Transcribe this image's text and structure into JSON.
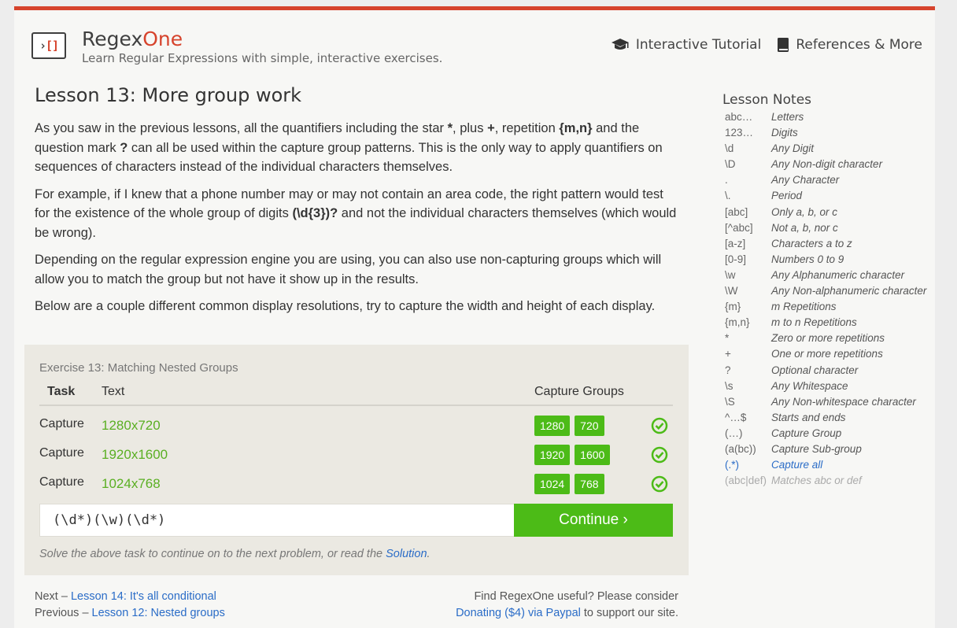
{
  "header": {
    "brand_prefix": "Regex",
    "brand_suffix": "One",
    "logo_gt": "›",
    "logo_brackets": "[]",
    "tagline": "Learn Regular Expressions with simple, interactive exercises.",
    "nav": [
      {
        "label": "Interactive Tutorial",
        "icon": "graduation-cap-icon"
      },
      {
        "label": "References & More",
        "icon": "book-icon"
      }
    ]
  },
  "lesson": {
    "title": "Lesson 13: More group work",
    "p1": {
      "a": "As you saw in the previous lessons, all the quantifiers including the star ",
      "star": "*",
      "b": ", plus ",
      "plus": "+",
      "c": ", repetition ",
      "rep": "{m,n}",
      "d": " and the question mark ",
      "qm": "?",
      "e": " can all be used within the capture group patterns. This is the only way to apply quantifiers on sequences of characters instead of the individual characters themselves."
    },
    "p2": {
      "a": "For example, if I knew that a phone number may or may not contain an area code, the right pattern would test for the existence of the whole group of digits ",
      "code": "(\\d{3})?",
      "b": " and not the individual characters themselves (which would be wrong)."
    },
    "p3": "Depending on the regular expression engine you are using, you can also use non-capturing groups which will allow you to match the group but not have it show up in the results.",
    "p4": "Below are a couple different common display resolutions, try to capture the width and height of each display."
  },
  "exercise": {
    "title": "Exercise 13: Matching Nested Groups",
    "columns": {
      "task": "Task",
      "text": "Text",
      "groups": "Capture Groups"
    },
    "rows": [
      {
        "task": "Capture",
        "text": "1280x720",
        "groups": [
          "1280",
          "720"
        ],
        "status": "check-circle-icon"
      },
      {
        "task": "Capture",
        "text": "1920x1600",
        "groups": [
          "1920",
          "1600"
        ],
        "status": "check-circle-icon"
      },
      {
        "task": "Capture",
        "text": "1024x768",
        "groups": [
          "1024",
          "768"
        ],
        "status": "check-circle-icon"
      }
    ],
    "input_value": "(\\d*)(\\w)(\\d*)",
    "continue_label": "Continue ›",
    "hint_prefix": "Solve the above task to continue on to the next problem, or read the ",
    "hint_link": "Solution",
    "hint_suffix": "."
  },
  "footer": {
    "next_prefix": "Next – ",
    "next_link": "Lesson 14: It's all conditional",
    "prev_prefix": "Previous – ",
    "prev_link": "Lesson 12: Nested groups",
    "support_line1": "Find RegexOne useful? Please consider",
    "donate_link": "Donating ($4) via Paypal",
    "support_suffix": " to support our site."
  },
  "notes": {
    "title": "Lesson Notes",
    "items": [
      {
        "sym": "abc…",
        "desc": "Letters"
      },
      {
        "sym": "123…",
        "desc": "Digits"
      },
      {
        "sym": "\\d",
        "desc": "Any Digit"
      },
      {
        "sym": "\\D",
        "desc": "Any Non-digit character"
      },
      {
        "sym": ".",
        "desc": "Any Character"
      },
      {
        "sym": "\\.",
        "desc": "Period"
      },
      {
        "sym": "[abc]",
        "desc": "Only a, b, or c"
      },
      {
        "sym": "[^abc]",
        "desc": "Not a, b, nor c"
      },
      {
        "sym": "[a-z]",
        "desc": "Characters a to z"
      },
      {
        "sym": "[0-9]",
        "desc": "Numbers 0 to 9"
      },
      {
        "sym": "\\w",
        "desc": "Any Alphanumeric character"
      },
      {
        "sym": "\\W",
        "desc": "Any Non-alphanumeric character"
      },
      {
        "sym": "{m}",
        "desc": "m Repetitions"
      },
      {
        "sym": "{m,n}",
        "desc": "m to n Repetitions"
      },
      {
        "sym": "*",
        "desc": "Zero or more repetitions"
      },
      {
        "sym": "+",
        "desc": "One or more repetitions"
      },
      {
        "sym": "?",
        "desc": "Optional character"
      },
      {
        "sym": "\\s",
        "desc": "Any Whitespace"
      },
      {
        "sym": "\\S",
        "desc": "Any Non-whitespace character"
      },
      {
        "sym": "^…$",
        "desc": "Starts and ends"
      },
      {
        "sym": "(…)",
        "desc": "Capture Group"
      },
      {
        "sym": "(a(bc))",
        "desc": "Capture Sub-group"
      },
      {
        "sym": "(.*)",
        "desc": "Capture all",
        "state": "active"
      },
      {
        "sym": "(abc|def)",
        "desc": "Matches abc or def",
        "state": "faded"
      }
    ]
  },
  "colors": {
    "accent": "#d6432c",
    "success": "#4cbb17",
    "link": "#2a6cc7"
  }
}
